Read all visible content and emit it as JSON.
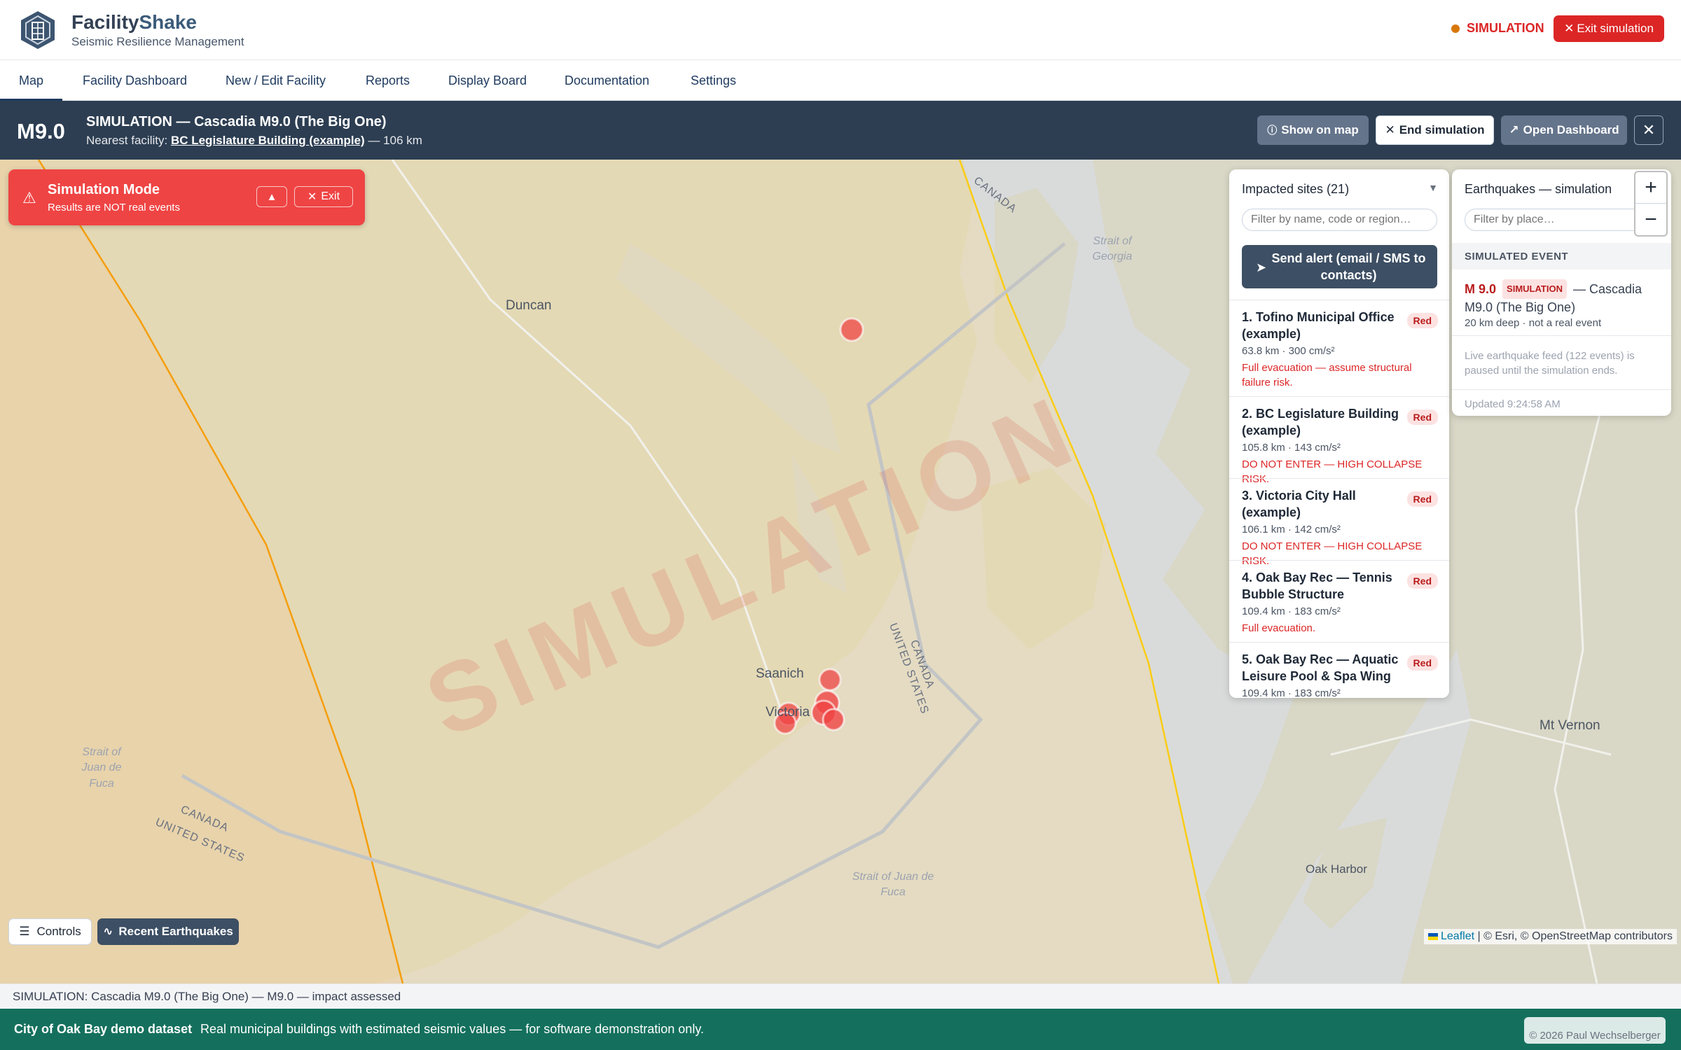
{
  "header": {
    "brand_part1": "Facility",
    "brand_part2": "Shake",
    "subtitle": "Seismic Resilience Management",
    "sim_status": "SIMULATION",
    "exit_button": "Exit simulation"
  },
  "nav": {
    "items": [
      "Map",
      "Facility Dashboard",
      "New / Edit Facility",
      "Reports",
      "Display Board",
      "Documentation",
      "Settings"
    ],
    "active": "Map"
  },
  "event_banner": {
    "magnitude": "M9.0",
    "title": "SIMULATION — Cascadia M9.0 (The Big One)",
    "nearest_prefix": "Nearest facility:",
    "nearest_name": "BC Legislature Building (example)",
    "nearest_distance": "— 106 km",
    "show_on_map": "Show on map",
    "end_simulation": "End simulation",
    "open_dashboard": "Open Dashboard"
  },
  "sim_mode": {
    "title": "Simulation Mode",
    "subtitle": "Results are NOT real events",
    "exit": "Exit"
  },
  "map_labels": {
    "duncan": "Duncan",
    "saanich": "Saanich",
    "victoria": "Victoria",
    "mt_vernon": "Mt Vernon",
    "oak_harbor": "Oak Harbor",
    "strait_georgia": "Strait of Georgia",
    "strait_juan_west": "Strait of Juan de Fuca",
    "strait_juan_south": "Strait of Juan de Fuca",
    "canada": "CANADA",
    "us_canada_1": "UNITED STATES",
    "us_canada_2": "CANADA",
    "canada_us_1": "CANADA",
    "canada_us_2": "UNITED STATES",
    "watermark": "SIMULATION"
  },
  "impacted": {
    "title": "Impacted sites (21)",
    "filter_placeholder": "Filter by name, code or region…",
    "alert_button": "Send alert (email / SMS to contacts)",
    "sites": [
      {
        "name": "1. Tofino Municipal Office (example)",
        "badge": "Red",
        "meta": "63.8 km · 300 cm/s²",
        "action": "Full evacuation — assume structural failure risk."
      },
      {
        "name": "2. BC Legislature Building (example)",
        "badge": "Red",
        "meta": "105.8 km · 143 cm/s²",
        "action": "DO NOT ENTER — HIGH COLLAPSE RISK."
      },
      {
        "name": "3. Victoria City Hall (example)",
        "badge": "Red",
        "meta": "106.1 km · 142 cm/s²",
        "action": "DO NOT ENTER — HIGH COLLAPSE RISK."
      },
      {
        "name": "4. Oak Bay Rec — Tennis Bubble Structure",
        "badge": "Red",
        "meta": "109.4 km · 183 cm/s²",
        "action": "Full evacuation."
      },
      {
        "name": "5. Oak Bay Rec — Aquatic Leisure Pool & Spa Wing",
        "badge": "Red",
        "meta": "109.4 km · 183 cm/s²",
        "action": ""
      }
    ]
  },
  "quakes": {
    "title": "Earthquakes — simulation",
    "filter_placeholder": "Filter by place…",
    "section": "SIMULATED EVENT",
    "event_mag": "M 9.0",
    "event_tag": "SIMULATION",
    "event_name": "— Cascadia M9.0 (The Big One)",
    "event_meta": "20 km deep · not a real event",
    "note": "Live earthquake feed (122 events) is paused until the simulation ends.",
    "updated": "Updated 9:24:58 AM"
  },
  "zoom": {
    "in": "+",
    "out": "−"
  },
  "controls": {
    "controls": "Controls",
    "recent": "Recent Earthquakes"
  },
  "attribution": {
    "leaflet": "Leaflet",
    "rest": " | © Esri, © OpenStreetMap contributors"
  },
  "status_line": "SIMULATION: Cascadia M9.0 (The Big One) — M9.0 — impact assessed",
  "footer": {
    "dataset": "City of Oak Bay demo dataset",
    "note": "Real municipal buildings with estimated seismic values — for software demonstration only.",
    "copyright": "© 2026 Paul Wechselberger"
  },
  "colors": {
    "danger": "#dc2626",
    "banner_bg": "#2d3e52",
    "footer_bg": "#14705d",
    "land": "#d9d7c6",
    "water": "#d9dbdb"
  },
  "icons": [
    "logo-icon",
    "close-icon",
    "info-icon",
    "warning-icon",
    "chevron-up-icon",
    "send-icon",
    "menu-icon",
    "pulse-icon",
    "external-link-icon"
  ]
}
